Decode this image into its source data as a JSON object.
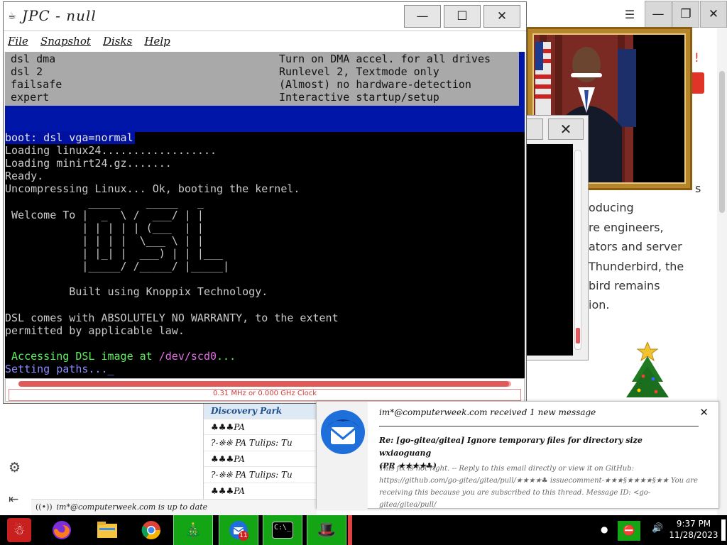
{
  "jpc": {
    "title": "JPC - null",
    "menu": [
      "File",
      "Snapshot",
      "Disks",
      "Help"
    ],
    "controls": {
      "minimize": "—",
      "maximize": "☐",
      "close": "✕"
    },
    "terminal": {
      "boot_menu": [
        {
          "option": "dsl dma",
          "desc": "Turn on DMA accel. for all drives"
        },
        {
          "option": "dsl 2",
          "desc": "Runlevel 2, Textmode only"
        },
        {
          "option": "failsafe",
          "desc": "(Almost) no hardware-detection"
        },
        {
          "option": "expert",
          "desc": "Interactive startup/setup"
        }
      ],
      "boot_prompt": "boot: dsl vga=normal",
      "lines": [
        "Loading linux24..................",
        "Loading minirt24.gz.......",
        "Ready.",
        "Uncompressing Linux... Ok, booting the kernel."
      ],
      "logo_lines": [
        " Welcome To |  _  \\ /  ___/ | |",
        "            | | | | | (___  | |",
        "            | | | |  \\___ \\ | |",
        "            | |_| |  ___) | | |___",
        "            |_____/ /_____/ |_____|"
      ],
      "logo_top": "             _____    _____   _",
      "built_line": "          Built using Knoppix Technology.",
      "warranty_1": "DSL comes with ABSOLUTELY NO WARRANTY, to the extent",
      "warranty_2": "permitted by applicable law.",
      "accessing_prefix": " Accessing DSL image at ",
      "accessing_path": "/dev/scd0",
      "accessing_suffix": "...",
      "setting_paths": "Setting paths..._"
    },
    "progress": 0.995,
    "clock_text": "0.31 MHz or 0.000 GHz Clock"
  },
  "background": {
    "excl": "!",
    "article_lines": [
      "s",
      "oducing",
      "re engineers,",
      "ators and server",
      "Thunderbird, the",
      "bird remains",
      "ion."
    ],
    "status": "im*@computerweek.com is up to date",
    "mail_list": [
      "Discovery Park",
      "♣♣♣PA",
      "?-※※ PA Tulips: Tu",
      "♣♣♣PA",
      "?-※※ PA Tulips: Tu",
      "♣♣♣PA"
    ]
  },
  "notification": {
    "sender": "im*@computerweek.com received 1 new message",
    "subject_line1": "Re: [go-gitea/gitea] Ignore temporary files for directory size   wxiaoguang",
    "subject_line2": "(PR ★★★★♣)",
    "body": "This fix is not right. -- Reply to this email directly or view it on GitHub: https://github.com/go-gitea/gitea/pull/★★★★♣ issuecomment-★★★§★★★★§★★ You are receiving this because you are subscribed to this thread. Message ID: <go-gitea/gitea/pull/",
    "close": "✕"
  },
  "taskbar": {
    "time": "9:37 PM",
    "date": "11/28/2023",
    "badge": "11",
    "icons": [
      "santa-icon",
      "firefox-icon",
      "explorer-icon",
      "chrome-icon",
      "tree-icon",
      "thunderbird-icon",
      "terminal-icon",
      "hat-icon"
    ]
  },
  "colors": {
    "terminal_bg": "#000000",
    "dsl_blue": "#0016a8",
    "menu_grey": "#a9a9a9",
    "taskbar_green": "#13a513",
    "clock_red": "#d23a3a"
  }
}
